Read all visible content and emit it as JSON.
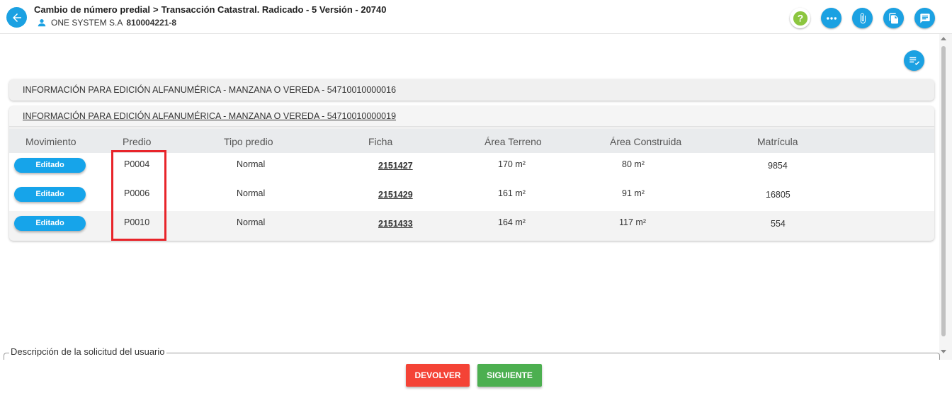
{
  "header": {
    "breadcrumb_1": "Cambio de número predial",
    "breadcrumb_sep": ">",
    "breadcrumb_2": "Transacción Catastral. Radicado - 5 Versión - 20740",
    "user_name": "ONE SYSTEM S.A",
    "user_nit": "810004221-8",
    "help_color": "#8cc63f",
    "accent_color": "#1ba1e2"
  },
  "icons": {
    "back": "arrow-left-icon",
    "help": "help-icon",
    "more": "more-horizontal-icon",
    "attach": "paperclip-icon",
    "docs": "documents-icon",
    "comments": "comment-icon",
    "list_check": "list-check-icon",
    "user": "person-icon"
  },
  "panels": {
    "panel1_title": "INFORMACIÓN PARA EDICIÓN ALFANUMÉRICA - MANZANA O VEREDA - 54710010000016",
    "panel2_title": "INFORMACIÓN PARA EDICIÓN ALFANUMÉRICA - MANZANA O VEREDA - 54710010000019"
  },
  "table": {
    "columns": [
      "Movimiento",
      "Predio",
      "Tipo predio",
      "Ficha",
      "Área Terreno",
      "Área Construida",
      "Matrícula"
    ],
    "rows": [
      {
        "movimiento": "Editado",
        "predio": "P0004",
        "tipo": "Normal",
        "ficha": "2151427",
        "area_terreno": "170 m²",
        "area_construida": "80 m²",
        "matricula": "9854"
      },
      {
        "movimiento": "Editado",
        "predio": "P0006",
        "tipo": "Normal",
        "ficha": "2151429",
        "area_terreno": "161 m²",
        "area_construida": "91 m²",
        "matricula": "16805"
      },
      {
        "movimiento": "Editado",
        "predio": "P0010",
        "tipo": "Normal",
        "ficha": "2151433",
        "area_terreno": "164 m²",
        "area_construida": "117 m²",
        "matricula": "554"
      }
    ]
  },
  "description": {
    "legend": "Descripción de la solicitud del usuario"
  },
  "footer": {
    "devolver_label": "DEVOLVER",
    "siguiente_label": "SIGUIENTE"
  }
}
